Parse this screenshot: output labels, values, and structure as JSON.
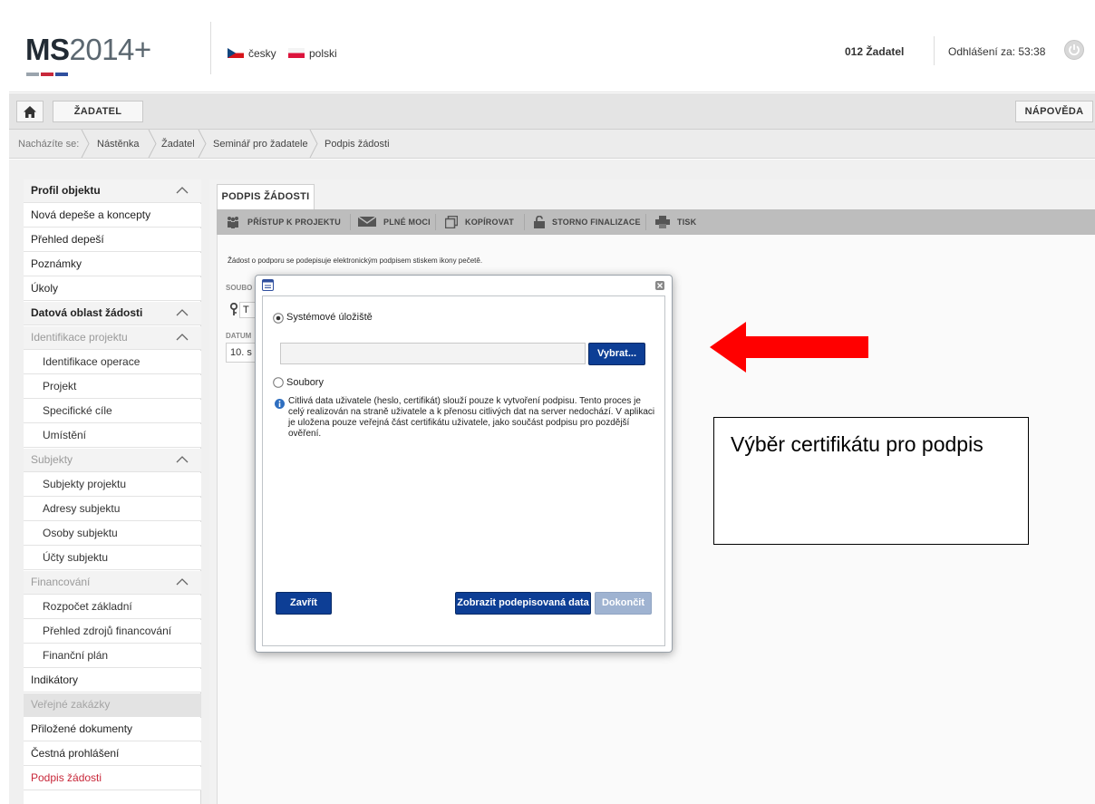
{
  "header": {
    "logo_ms": "MS",
    "logo_rest": "2014+",
    "logo_bar_colors": [
      "#9aa4ad",
      "#c8283a",
      "#2f4f9e"
    ],
    "languages": [
      {
        "label": "česky",
        "flag_colors": [
          "#d7141a",
          "#11457e",
          "#ffffff"
        ]
      },
      {
        "label": "polski",
        "flag_colors": [
          "#ffffff",
          "#dc143c"
        ]
      }
    ],
    "user": "012 Žadatel",
    "logout_timer": "Odhlášení za: 53:38"
  },
  "toolbar": {
    "zadatel_label": "ŽADATEL",
    "help_label": "NÁPOVĚDA"
  },
  "breadcrumb": {
    "prefix": "Nacházíte se:",
    "items": [
      "Nástěnka",
      "Žadatel",
      "Seminář pro žadatele",
      "Podpis žádosti"
    ]
  },
  "sidebar": {
    "items": [
      {
        "label": "Profil objektu",
        "kind": "sec"
      },
      {
        "label": "Nová depeše a koncepty",
        "kind": "item"
      },
      {
        "label": "Přehled depeší",
        "kind": "item"
      },
      {
        "label": "Poznámky",
        "kind": "item"
      },
      {
        "label": "Úkoly",
        "kind": "item"
      },
      {
        "label": "Datová oblast žádosti",
        "kind": "sec"
      },
      {
        "label": "Identifikace projektu",
        "kind": "secgrey"
      },
      {
        "label": "Identifikace operace",
        "kind": "sub"
      },
      {
        "label": "Projekt",
        "kind": "sub"
      },
      {
        "label": "Specifické cíle",
        "kind": "sub"
      },
      {
        "label": "Umístění",
        "kind": "sub"
      },
      {
        "label": "Subjekty",
        "kind": "secgrey"
      },
      {
        "label": "Subjekty projektu",
        "kind": "sub"
      },
      {
        "label": "Adresy subjektu",
        "kind": "sub"
      },
      {
        "label": "Osoby subjektu",
        "kind": "sub"
      },
      {
        "label": "Účty subjektu",
        "kind": "sub"
      },
      {
        "label": "Financování",
        "kind": "secgrey"
      },
      {
        "label": "Rozpočet základní",
        "kind": "sub"
      },
      {
        "label": "Přehled zdrojů financování",
        "kind": "sub"
      },
      {
        "label": "Finanční plán",
        "kind": "sub"
      },
      {
        "label": "Indikátory",
        "kind": "item"
      },
      {
        "label": "Veřejné zakázky",
        "kind": "dim"
      },
      {
        "label": "Přiložené dokumenty",
        "kind": "item"
      },
      {
        "label": "Čestná prohlášení",
        "kind": "item"
      },
      {
        "label": "Podpis žádosti",
        "kind": "active"
      }
    ]
  },
  "content": {
    "tab_label": "PODPIS ŽÁDOSTI",
    "actions": [
      "PŘÍSTUP K PROJEKTU",
      "PLNÉ MOCI",
      "KOPÍROVAT",
      "STORNO FINALIZACE",
      "TISK"
    ],
    "intro": "Žádost o podporu se podepisuje elektronickým podpisem stiskem ikony pečetě.",
    "file_label": "SOUBO",
    "file_value": "T",
    "date_label": "DATUM",
    "date_value": "10. s"
  },
  "modal": {
    "option_system": "Systémové úložiště",
    "cert_value": "",
    "browse_label": "Vybrat...",
    "option_files": "Soubory",
    "info": "Citlivá data uživatele (heslo, certifikát) slouží pouze k vytvoření podpisu. Tento proces je celý realizován na straně uživatele a k přenosu citlivých dat na server nedochází. V aplikaci je uložena pouze veřejná část certifikátu uživatele, jako součást podpisu pro pozdější ověření.",
    "close_label": "Zavřít",
    "show_data_label": "Zobrazit podepisovaná data",
    "finish_label": "Dokončit"
  },
  "annotation": {
    "callout": "Výběr certifikátu pro podpis",
    "arrow_color": "#ff0000"
  }
}
